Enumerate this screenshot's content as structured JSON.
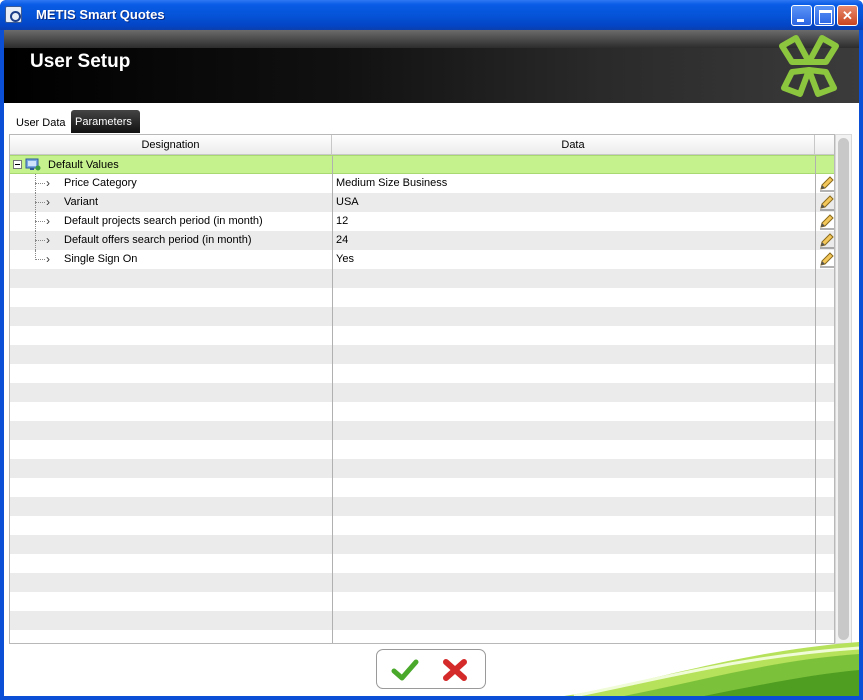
{
  "window": {
    "title": "METIS Smart Quotes",
    "buttons": [
      "minimize",
      "maximize",
      "close"
    ]
  },
  "header": {
    "title": "User Setup",
    "logo_icon": "metis-clover-logo"
  },
  "tabs": [
    {
      "label": "User Data",
      "active": false
    },
    {
      "label": "Parameters",
      "active": true
    }
  ],
  "grid": {
    "columns": [
      "Designation",
      "Data"
    ],
    "group": {
      "label": "Default Values",
      "expanded": true,
      "icon": "folder-network-icon"
    },
    "rows": [
      {
        "designation": "Price Category",
        "data": "Medium Size Business"
      },
      {
        "designation": "Variant",
        "data": "USA"
      },
      {
        "designation": "Default projects search period (in month)",
        "data": "12"
      },
      {
        "designation": "Default offers search period (in month)",
        "data": "24"
      },
      {
        "designation": "Single Sign On",
        "data": "Yes"
      }
    ],
    "row_icon": "pencil-edit-icon"
  },
  "actions": {
    "ok_icon": "green-checkmark-icon",
    "cancel_icon": "red-x-icon"
  },
  "colors": {
    "title_bar": "#0554d8",
    "group_row": "#c6f28e",
    "accent_green": "#8cc63f"
  }
}
